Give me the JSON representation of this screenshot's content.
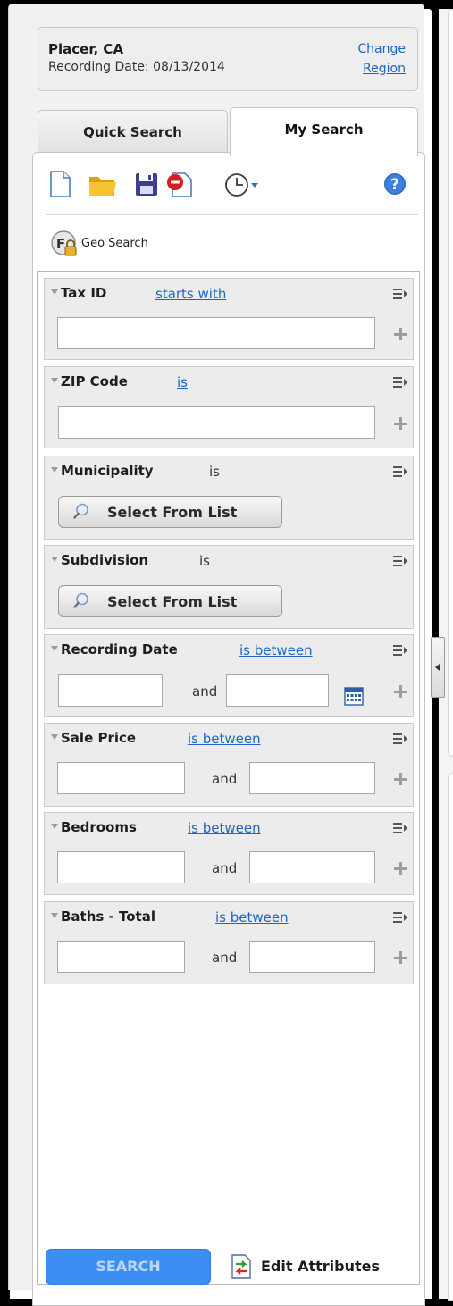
{
  "region": {
    "name": "Placer, CA",
    "recording_date": "Recording Date: 08/13/2014",
    "change_line1": "Change",
    "change_line2": "Region"
  },
  "tabs": [
    {
      "label": "Quick Search",
      "active": false
    },
    {
      "label": "My Search",
      "active": true
    }
  ],
  "toolbar": {
    "icons": [
      "new-document-icon",
      "open-folder-icon",
      "save-icon",
      "delete-icon",
      "history-clock-icon",
      "help-icon"
    ]
  },
  "geo_search": {
    "label": "Geo Search"
  },
  "criteria": {
    "tax_id": {
      "title": "Tax ID",
      "operator": "starts with",
      "value": ""
    },
    "zip_code": {
      "title": "ZIP Code",
      "operator": "is",
      "value": ""
    },
    "municipality": {
      "title": "Municipality",
      "operator": "is",
      "button": "Select From List"
    },
    "subdivision": {
      "title": "Subdivision",
      "operator": "is",
      "button": "Select From List"
    },
    "recording_date": {
      "title": "Recording Date",
      "operator": "is between",
      "and": "and",
      "from": "",
      "to": ""
    },
    "sale_price": {
      "title": "Sale Price",
      "operator": "is between",
      "and": "and",
      "from": "",
      "to": ""
    },
    "bedrooms": {
      "title": "Bedrooms",
      "operator": "is between",
      "and": "and",
      "from": "",
      "to": ""
    },
    "baths_total": {
      "title": "Baths - Total",
      "operator": "is between",
      "and": "and",
      "from": "",
      "to": ""
    }
  },
  "footer": {
    "search_label": "SEARCH",
    "edit_attributes_label": "Edit Attributes"
  },
  "colors": {
    "link": "#1d67c4",
    "search_button": "#3c8ef4",
    "search_button_text": "#b9d6fb"
  }
}
